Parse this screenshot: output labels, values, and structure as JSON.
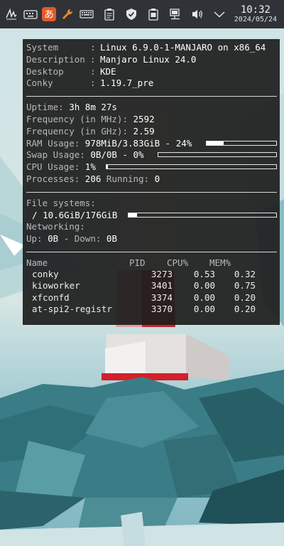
{
  "clock": {
    "time": "10:32",
    "date": "2024/05/24"
  },
  "tray_icons": [
    "handwriting-icon",
    "keyboard-icon",
    "input-method-icon",
    "wrench-icon",
    "keyboard-layout-icon",
    "clipboard-icon",
    "shield-icon",
    "notes-icon",
    "network-icon",
    "volume-icon",
    "chevron-down-icon"
  ],
  "input_method_glyph": "あ",
  "conky": {
    "system": [
      {
        "key": "System",
        "value": "Linux 6.9.0-1-MANJARO on x86_64"
      },
      {
        "key": "Description",
        "value": "Manjaro Linux 24.0"
      },
      {
        "key": "Desktop",
        "value": "KDE"
      },
      {
        "key": "Conky",
        "value": "1.19.7_pre"
      }
    ],
    "uptime_label": "Uptime:",
    "uptime": "3h 8m 27s",
    "freq_mhz_label": "Frequency (in MHz):",
    "freq_mhz": "2592",
    "freq_ghz_label": "Frequency (in GHz):",
    "freq_ghz": "2.59",
    "ram_label": "RAM Usage:",
    "ram_value": "978MiB/3.83GiB - 24%",
    "ram_percent": 24,
    "swap_label": "Swap Usage:",
    "swap_value": "0B/0B - 0%",
    "swap_percent": 0,
    "cpu_label": "CPU Usage:",
    "cpu_value": "1%",
    "cpu_percent": 1,
    "processes_label": "Processes:",
    "processes": "206",
    "running_label": "Running:",
    "running": "0",
    "fs_title": "File systems:",
    "fs_mount": "/",
    "fs_value": "10.6GiB/176GiB",
    "fs_percent": 6,
    "net_title": "Networking:",
    "up_label": "Up:",
    "up_value": "0B",
    "down_label": "- Down:",
    "down_value": "0B",
    "proc_headers": {
      "name": "Name",
      "pid": "PID",
      "cpu": "CPU%",
      "mem": "MEM%"
    },
    "procs": [
      {
        "name": "conky",
        "pid": "3273",
        "cpu": "0.53",
        "mem": "0.32"
      },
      {
        "name": "kioworker",
        "pid": "3401",
        "cpu": "0.00",
        "mem": "0.75"
      },
      {
        "name": "xfconfd",
        "pid": "3374",
        "cpu": "0.00",
        "mem": "0.20"
      },
      {
        "name": "at-spi2-registr",
        "pid": "3370",
        "cpu": "0.00",
        "mem": "0.20"
      }
    ]
  }
}
